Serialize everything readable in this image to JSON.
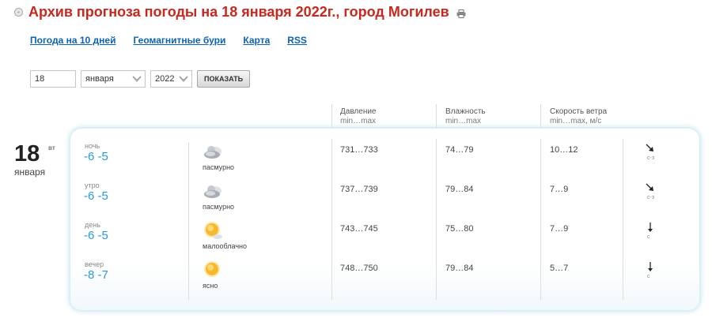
{
  "page": {
    "title": "Архив прогноза погоды на 18 января 2022г., город Могилев"
  },
  "nav": {
    "items": [
      {
        "label": "Погода на 10 дней"
      },
      {
        "label": "Геомагнитные бури"
      },
      {
        "label": "Карта"
      },
      {
        "label": "RSS"
      }
    ]
  },
  "form": {
    "day": "18",
    "month": "января",
    "year": "2022",
    "show_label": "ПОКАЗАТЬ"
  },
  "columns": {
    "pressure": {
      "label": "Давление",
      "sub": "min…max"
    },
    "humidity": {
      "label": "Влажность",
      "sub": "min…max"
    },
    "wind": {
      "label": "Скорость ветра",
      "sub": "min…max, м/с"
    }
  },
  "date": {
    "day": "18",
    "weekday": "вт",
    "month": "января"
  },
  "rows": [
    {
      "period": "ночь",
      "temp": "-6 -5",
      "icon": "overcast-cloud-icon",
      "condition": "пасмурно",
      "pressure": "731…733",
      "humidity": "74…79",
      "wind": "10…12",
      "wind_icon": "arrow-down-right-icon",
      "wind_dir": "с-з"
    },
    {
      "period": "утро",
      "temp": "-6 -5",
      "icon": "overcast-cloud-icon",
      "condition": "пасмурно",
      "pressure": "737…739",
      "humidity": "79…84",
      "wind": "7…9",
      "wind_icon": "arrow-down-right-icon",
      "wind_dir": "с-з"
    },
    {
      "period": "день",
      "temp": "-6 -5",
      "icon": "sun-icon",
      "condition": "малооблачно",
      "pressure": "743…745",
      "humidity": "75…80",
      "wind": "7…9",
      "wind_icon": "arrow-down-icon",
      "wind_dir": "с"
    },
    {
      "period": "вечер",
      "temp": "-8 -7",
      "icon": "sun-icon",
      "condition": "ясно",
      "pressure": "748…750",
      "humidity": "79…84",
      "wind": "5…7",
      "wind_icon": "arrow-down-icon",
      "wind_dir": "с"
    }
  ],
  "colors": {
    "title": "#c8281e",
    "link": "#0c62b4",
    "temperature": "#2a9ad6",
    "card_glow": "#c6e6ee"
  }
}
